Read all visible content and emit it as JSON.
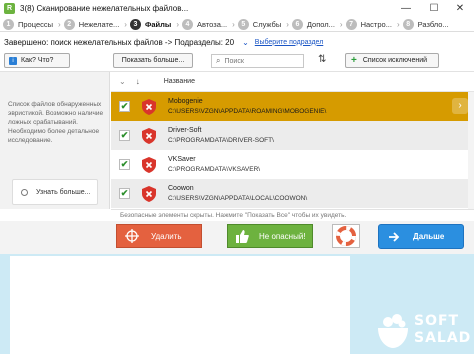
{
  "window": {
    "title": "3(8) Сканирование нежелательных файлов...",
    "app_icon": "R",
    "controls": {
      "minimize": "—",
      "maximize": "☐",
      "close": "✕"
    }
  },
  "steps": [
    {
      "num": "1",
      "label": "Процессы"
    },
    {
      "num": "2",
      "label": "Нежелате..."
    },
    {
      "num": "3",
      "label": "Файлы"
    },
    {
      "num": "4",
      "label": "Автоза..."
    },
    {
      "num": "5",
      "label": "Службы"
    },
    {
      "num": "6",
      "label": "Допол..."
    },
    {
      "num": "7",
      "label": "Настро..."
    },
    {
      "num": "8",
      "label": "Разбло..."
    }
  ],
  "status": {
    "text": "Завершено: поиск нежелательных файлов -> Подразделы: 20",
    "link": "Выберите подраздел"
  },
  "toolbar": {
    "whatisit": "Как? Что?",
    "similar": "Показать больше...",
    "search_placeholder": "Поиск",
    "exclusions": "Список исключений"
  },
  "left_panel": {
    "description": "Список файлов обнаруженных эвристикой. Возможно наличие ложных срабатываний. Необходимо более детальное исследование.",
    "learn_more": "Узнать больше..."
  },
  "list": {
    "column_name": "Название",
    "rows": [
      {
        "name": "Mobogenie",
        "path": "C:\\USERS\\VZGN\\APPDATA\\ROAMING\\MOBOGENIE\\"
      },
      {
        "name": "Driver-Soft",
        "path": "C:\\PROGRAMDATA\\DRIVER-SOFT\\"
      },
      {
        "name": "VKSaver",
        "path": "C:\\PROGRAMDATA\\VKSAVER\\"
      },
      {
        "name": "Coowon",
        "path": "C:\\USERS\\VZGN\\APPDATA\\LOCAL\\COOWON\\"
      }
    ]
  },
  "footnote": "Безопасные элементы скрыты. Нажмите \"Показать Все\" чтобы их увидеть.",
  "actions": {
    "delete": "Удалить",
    "safe": "Не опасный!",
    "next": "Дальше"
  },
  "watermark": {
    "line1": "SOFT",
    "line2": "SALAD"
  },
  "colors": {
    "selected_row": "#d69b00",
    "delete": "#e4613f",
    "safe": "#6db23f",
    "next": "#2b8fe0",
    "shield": "#d9352b"
  }
}
